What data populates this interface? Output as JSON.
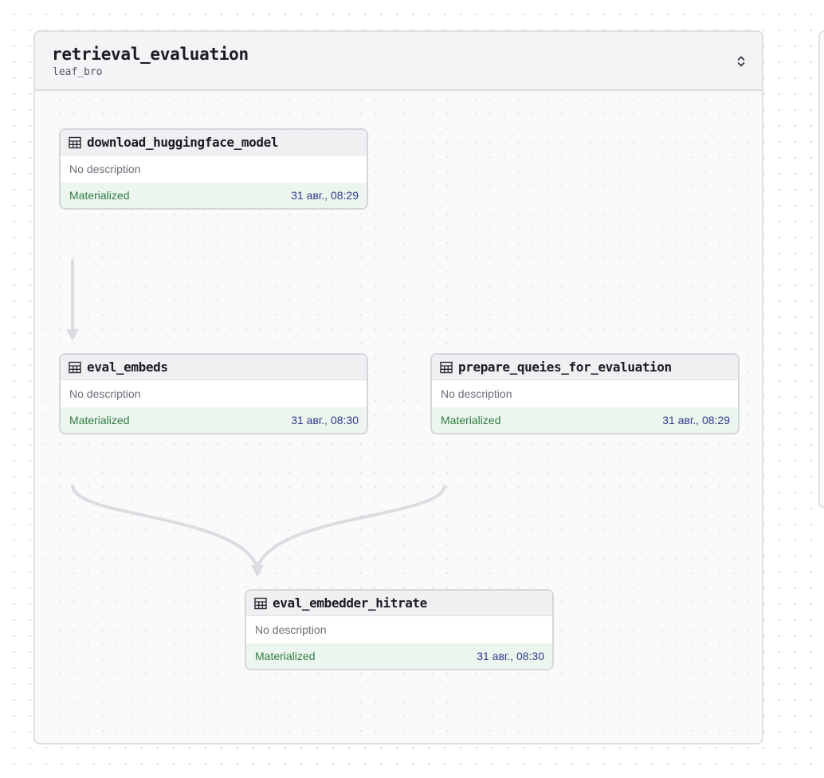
{
  "group": {
    "title": "retrieval_evaluation",
    "subtitle": "leaf_bro",
    "collapse_icon": "chevron-up-down-icon"
  },
  "assets": [
    {
      "name": "download_huggingface_model",
      "description": "No description",
      "status": "Materialized",
      "timestamp": "31 авг., 08:29",
      "icon": "table-icon"
    },
    {
      "name": "eval_embeds",
      "description": "No description",
      "status": "Materialized",
      "timestamp": "31 авг., 08:30",
      "icon": "table-icon"
    },
    {
      "name": "prepare_queies_for_evaluation",
      "description": "No description",
      "status": "Materialized",
      "timestamp": "31 авг., 08:29",
      "icon": "table-icon"
    },
    {
      "name": "eval_embedder_hitrate",
      "description": "No description",
      "status": "Materialized",
      "timestamp": "31 авг., 08:30",
      "icon": "table-icon"
    }
  ],
  "edges": [
    {
      "from": "download_huggingface_model",
      "to": "eval_embeds"
    },
    {
      "from": "eval_embeds",
      "to": "eval_embedder_hitrate"
    },
    {
      "from": "prepare_queies_for_evaluation",
      "to": "eval_embedder_hitrate"
    }
  ],
  "colors": {
    "status_text": "#2e7d45",
    "status_bg": "#edf6ee",
    "timestamp": "#2f3a8f",
    "edge": "#dcdde3"
  }
}
